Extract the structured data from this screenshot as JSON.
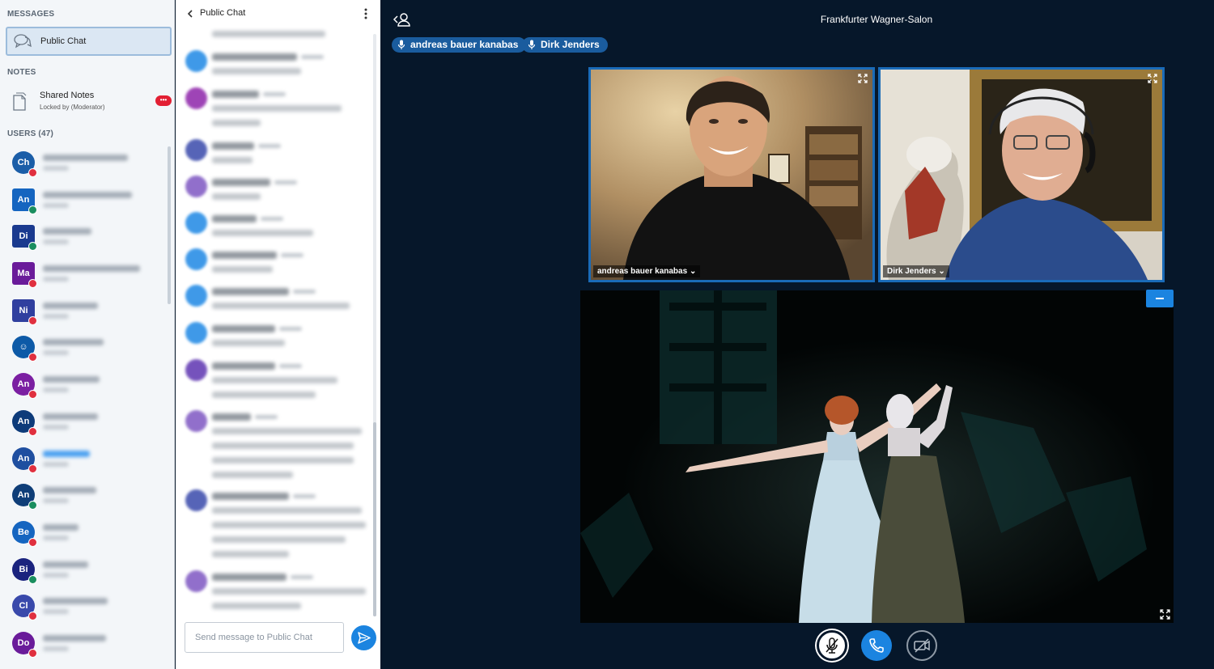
{
  "sidebar": {
    "messages_title": "MESSAGES",
    "public_chat_label": "Public Chat",
    "notes_title": "NOTES",
    "shared_notes_title": "Shared Notes",
    "shared_notes_status": "Locked by (Moderator)",
    "shared_notes_badge": "•••",
    "users_title": "USERS (47)",
    "users": [
      {
        "initials": "Ch",
        "color": "#1b5ea8",
        "status": "muted"
      },
      {
        "initials": "An",
        "color": "#1565c0",
        "status": "talking",
        "square": true
      },
      {
        "initials": "Di",
        "color": "#1a3a8f",
        "status": "talking",
        "square": true
      },
      {
        "initials": "Ma",
        "color": "#6a1b9a",
        "status": "muted",
        "square": true
      },
      {
        "initials": "Ni",
        "color": "#303f9f",
        "status": "muted",
        "square": true
      },
      {
        "initials": "☺",
        "color": "#0d5aa7",
        "status": "muted"
      },
      {
        "initials": "An",
        "color": "#7b1fa2",
        "status": "muted"
      },
      {
        "initials": "An",
        "color": "#0d3b7a",
        "status": "muted"
      },
      {
        "initials": "An",
        "color": "#1f4fa0",
        "status": "muted",
        "highlight": true
      },
      {
        "initials": "An",
        "color": "#0f3e78",
        "status": "listen"
      },
      {
        "initials": "Be",
        "color": "#1565c0",
        "status": "muted"
      },
      {
        "initials": "Bi",
        "color": "#1a237e",
        "status": "listen"
      },
      {
        "initials": "Cl",
        "color": "#3949ab",
        "status": "muted"
      },
      {
        "initials": "Do",
        "color": "#6a1b9a",
        "status": "muted"
      }
    ]
  },
  "chat": {
    "title": "Public Chat",
    "input_placeholder": "Send message to Public Chat",
    "avatar_colors": [
      "#7e57c2",
      "#1e88e5",
      "#8e24aa",
      "#3949ab",
      "#7e57c2",
      "#1e88e5",
      "#1e88e5",
      "#1e88e5",
      "#1e88e5",
      "#5e35b1",
      "#7e57c2",
      "#3949ab"
    ]
  },
  "main": {
    "meeting_title": "Frankfurter Wagner-Salon",
    "talkers": [
      "andreas bauer kanabas",
      "Dirk Jenders"
    ],
    "webcams": [
      {
        "name": "andreas bauer kanabas ⌄"
      },
      {
        "name": "Dirk Jenders ⌄"
      }
    ]
  },
  "colors": {
    "accent": "#1b84e0",
    "dark_bg": "#06172a",
    "muted_status": "#e0303f",
    "talking_status": "#1a8e5f"
  }
}
